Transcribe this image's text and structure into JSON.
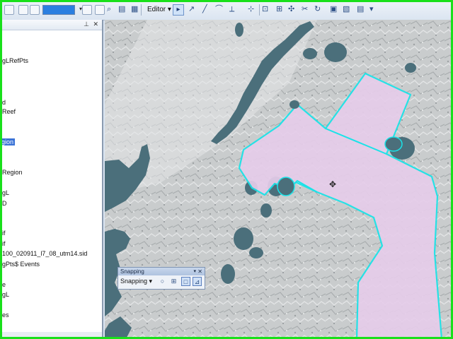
{
  "toolbar": {
    "editor_label": "Editor"
  },
  "toc": {
    "items": [
      {
        "label": "gLRefPts",
        "selected": false
      },
      {
        "label": "d",
        "selected": false
      },
      {
        "label": "Reef",
        "selected": false
      },
      {
        "label": "gion",
        "selected": true
      },
      {
        "label": "Region",
        "selected": false
      },
      {
        "label": "gL",
        "selected": false
      },
      {
        "label": "D",
        "selected": false
      },
      {
        "label": "if",
        "selected": false
      },
      {
        "label": "if",
        "selected": false
      },
      {
        "label": "100_020911_l7_08_utm14.sid",
        "selected": false
      },
      {
        "label": "gPts$ Events",
        "selected": false
      },
      {
        "label": "e",
        "selected": false
      },
      {
        "label": "gL",
        "selected": false
      },
      {
        "label": "es",
        "selected": false
      }
    ]
  },
  "snapping": {
    "title": "Snapping",
    "menu_label": "Snapping"
  },
  "colors": {
    "polygon_fill": "#e6cdea",
    "polygon_outline": "#19e3e8",
    "water": "#4b6f7b",
    "capture_border": "#19e01a",
    "selection": "#3b73d6"
  }
}
